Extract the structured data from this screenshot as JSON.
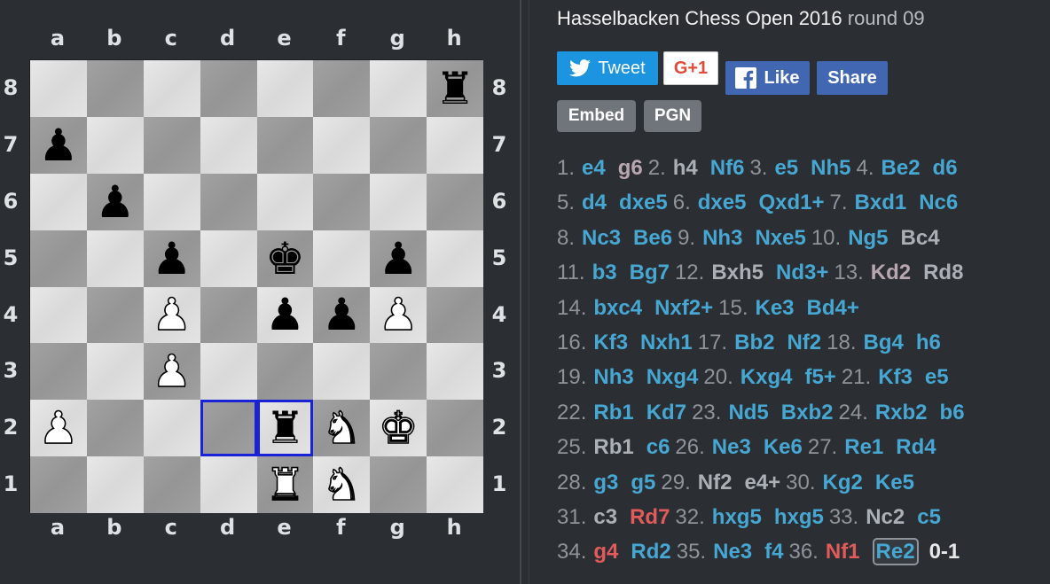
{
  "title": {
    "event": "Hasselbacken Chess Open 2016",
    "round": "round 09"
  },
  "files": [
    "a",
    "b",
    "c",
    "d",
    "e",
    "f",
    "g",
    "h"
  ],
  "ranks": [
    "8",
    "7",
    "6",
    "5",
    "4",
    "3",
    "2",
    "1"
  ],
  "board": [
    [
      "",
      "",
      "",
      "",
      "",
      "",
      "",
      "b:rook"
    ],
    [
      "b:pawn",
      "",
      "",
      "",
      "",
      "",
      "",
      ""
    ],
    [
      "",
      "b:pawn",
      "",
      "",
      "",
      "",
      "",
      ""
    ],
    [
      "",
      "",
      "b:pawn",
      "",
      "b:king",
      "",
      "b:pawn",
      ""
    ],
    [
      "",
      "",
      "w:pawn",
      "",
      "b:pawn",
      "b:pawn",
      "w:pawn",
      ""
    ],
    [
      "",
      "",
      "w:pawn",
      "",
      "",
      "",
      "",
      ""
    ],
    [
      "w:pawn",
      "",
      "",
      "",
      "b:rook",
      "w:knight",
      "w:king",
      ""
    ],
    [
      "",
      "",
      "",
      "",
      "w:rook",
      "w:knight",
      "",
      ""
    ]
  ],
  "last_move_squares": [
    "d2",
    "e2"
  ],
  "share": {
    "tweet": "Tweet",
    "gplus": "G+1",
    "like": "Like",
    "share": "Share"
  },
  "buttons": {
    "embed": "Embed",
    "pgn": "PGN"
  },
  "move_lines": [
    [
      [
        "1.",
        null
      ],
      [
        "e4",
        "blue"
      ],
      [
        "g6",
        "pink"
      ],
      [
        "2.",
        null
      ],
      [
        "h4",
        "gray"
      ],
      [
        "Nf6",
        "blue"
      ],
      [
        "3.",
        null
      ],
      [
        "e5",
        "blue"
      ],
      [
        "Nh5",
        "blue"
      ],
      [
        "4.",
        null
      ],
      [
        "Be2",
        "blue"
      ],
      [
        "d6",
        "blue"
      ]
    ],
    [
      [
        "5.",
        null
      ],
      [
        "d4",
        "blue"
      ],
      [
        "dxe5",
        "blue"
      ],
      [
        "6.",
        null
      ],
      [
        "dxe5",
        "blue"
      ],
      [
        "Qxd1+",
        "blue"
      ],
      [
        "7.",
        null
      ],
      [
        "Bxd1",
        "blue"
      ],
      [
        "Nc6",
        "blue"
      ]
    ],
    [
      [
        "8.",
        null
      ],
      [
        "Nc3",
        "blue"
      ],
      [
        "Be6",
        "blue"
      ],
      [
        "9.",
        null
      ],
      [
        "Nh3",
        "blue"
      ],
      [
        "Nxe5",
        "blue"
      ],
      [
        "10.",
        null
      ],
      [
        "Ng5",
        "blue"
      ],
      [
        "Bc4",
        "gray"
      ]
    ],
    [
      [
        "11.",
        null
      ],
      [
        "b3",
        "blue"
      ],
      [
        "Bg7",
        "blue"
      ],
      [
        "12.",
        null
      ],
      [
        "Bxh5",
        "gray"
      ],
      [
        "Nd3+",
        "blue"
      ],
      [
        "13.",
        null
      ],
      [
        "Kd2",
        "pink"
      ],
      [
        "Rd8",
        "gray"
      ]
    ],
    [
      [
        "14.",
        null
      ],
      [
        "bxc4",
        "blue"
      ],
      [
        "Nxf2+",
        "blue"
      ],
      [
        "15.",
        null
      ],
      [
        "Ke3",
        "blue"
      ],
      [
        "Bd4+",
        "blue"
      ]
    ],
    [
      [
        "16.",
        null
      ],
      [
        "Kf3",
        "blue"
      ],
      [
        "Nxh1",
        "blue"
      ],
      [
        "17.",
        null
      ],
      [
        "Bb2",
        "blue"
      ],
      [
        "Nf2",
        "blue"
      ],
      [
        "18.",
        null
      ],
      [
        "Bg4",
        "blue"
      ],
      [
        "h6",
        "blue"
      ]
    ],
    [
      [
        "19.",
        null
      ],
      [
        "Nh3",
        "blue"
      ],
      [
        "Nxg4",
        "blue"
      ],
      [
        "20.",
        null
      ],
      [
        "Kxg4",
        "blue"
      ],
      [
        "f5+",
        "blue"
      ],
      [
        "21.",
        null
      ],
      [
        "Kf3",
        "blue"
      ],
      [
        "e5",
        "blue"
      ]
    ],
    [
      [
        "22.",
        null
      ],
      [
        "Rb1",
        "blue"
      ],
      [
        "Kd7",
        "blue"
      ],
      [
        "23.",
        null
      ],
      [
        "Nd5",
        "blue"
      ],
      [
        "Bxb2",
        "blue"
      ],
      [
        "24.",
        null
      ],
      [
        "Rxb2",
        "blue"
      ],
      [
        "b6",
        "blue"
      ]
    ],
    [
      [
        "25.",
        null
      ],
      [
        "Rb1",
        "gray"
      ],
      [
        "c6",
        "blue"
      ],
      [
        "26.",
        null
      ],
      [
        "Ne3",
        "blue"
      ],
      [
        "Ke6",
        "blue"
      ],
      [
        "27.",
        null
      ],
      [
        "Re1",
        "blue"
      ],
      [
        "Rd4",
        "blue"
      ]
    ],
    [
      [
        "28.",
        null
      ],
      [
        "g3",
        "blue"
      ],
      [
        "g5",
        "blue"
      ],
      [
        "29.",
        null
      ],
      [
        "Nf2",
        "gray"
      ],
      [
        "e4+",
        "gray"
      ],
      [
        "30.",
        null
      ],
      [
        "Kg2",
        "blue"
      ],
      [
        "Ke5",
        "blue"
      ]
    ],
    [
      [
        "31.",
        null
      ],
      [
        "c3",
        "gray"
      ],
      [
        "Rd7",
        "red"
      ],
      [
        "32.",
        null
      ],
      [
        "hxg5",
        "blue"
      ],
      [
        "hxg5",
        "blue"
      ],
      [
        "33.",
        null
      ],
      [
        "Nc2",
        "gray"
      ],
      [
        "c5",
        "blue"
      ]
    ],
    [
      [
        "34.",
        null
      ],
      [
        "g4",
        "red"
      ],
      [
        "Rd2",
        "blue"
      ],
      [
        "35.",
        null
      ],
      [
        "Ne3",
        "blue"
      ],
      [
        "f4",
        "blue"
      ],
      [
        "36.",
        null
      ],
      [
        "Nf1",
        "red"
      ],
      [
        "Re2",
        "cur"
      ]
    ]
  ],
  "result": "0-1",
  "colors": {
    "background": "#2b2f33",
    "move_blue": "#46a7d3",
    "move_red": "#e15b5b",
    "highlight": "#1a22d6",
    "twitter": "#1c94e0",
    "facebook": "#4267b2"
  }
}
